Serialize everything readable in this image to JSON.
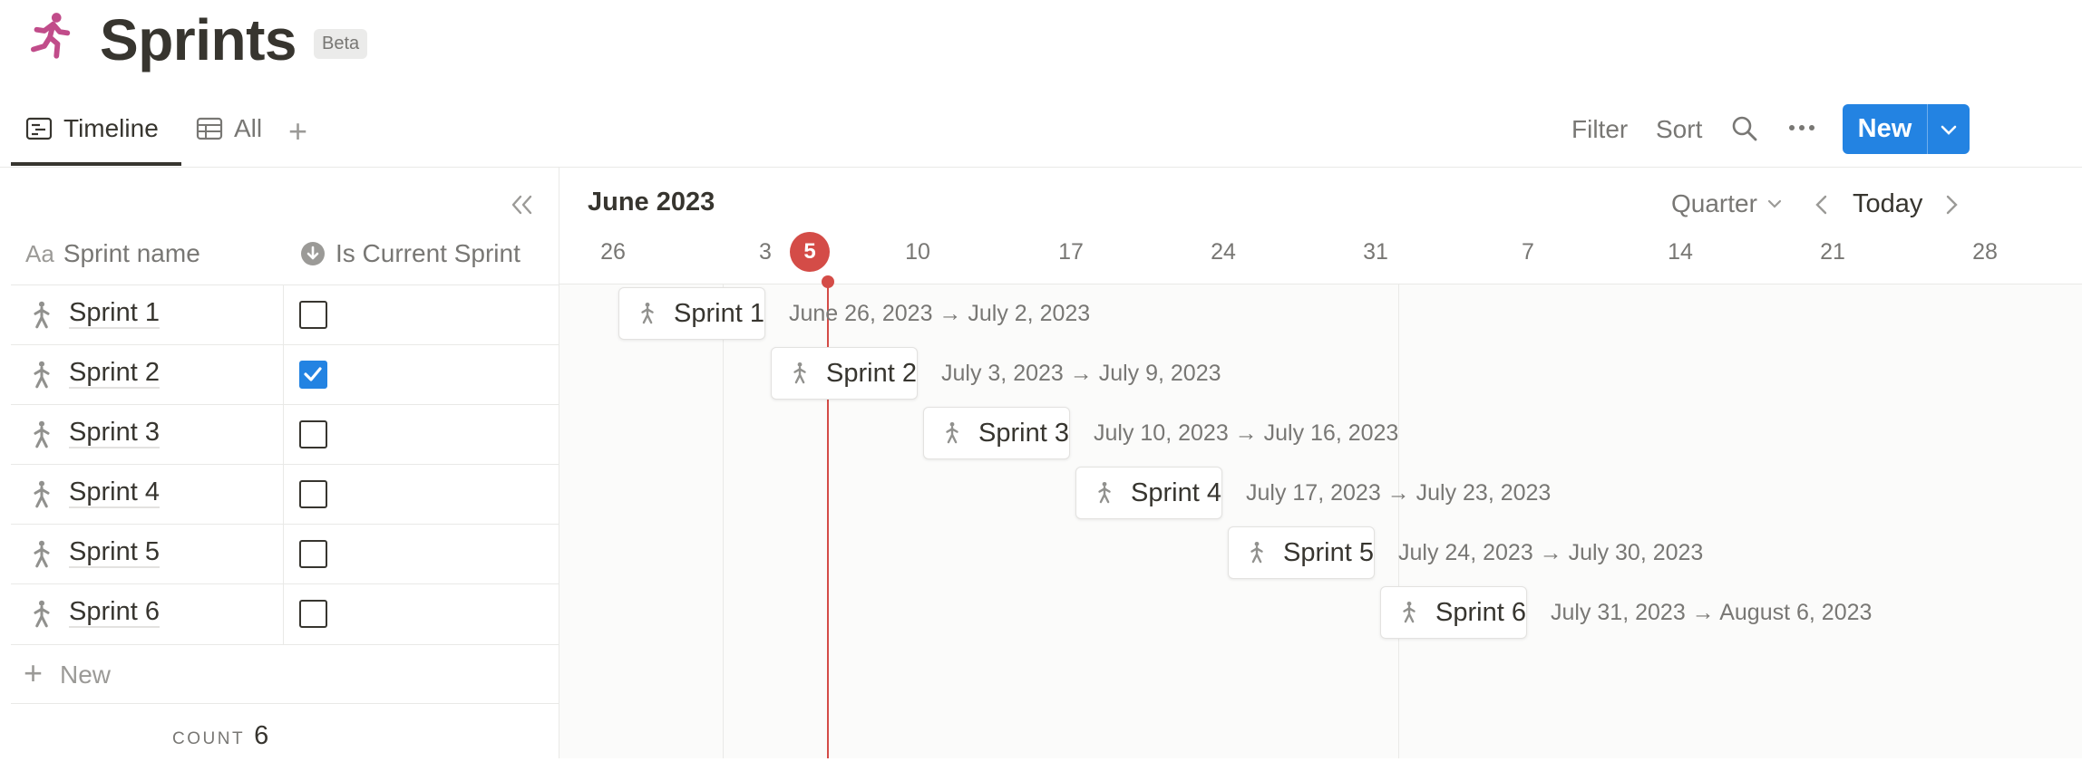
{
  "page": {
    "title": "Sprints",
    "badge": "Beta",
    "icon": "runner-icon",
    "icon_color": "#c14c8a"
  },
  "tabs": [
    {
      "label": "Timeline",
      "icon": "timeline-icon",
      "active": true
    },
    {
      "label": "All",
      "icon": "table-icon",
      "active": false
    }
  ],
  "toolbar": {
    "filter": "Filter",
    "sort": "Sort",
    "new": "New",
    "accent": "#2383e2"
  },
  "table": {
    "columns": {
      "name": "Sprint name",
      "name_prefix": "Aa",
      "current": "Is Current Sprint"
    },
    "rows": [
      {
        "name": "Sprint 1",
        "current": false
      },
      {
        "name": "Sprint 2",
        "current": true
      },
      {
        "name": "Sprint 3",
        "current": false
      },
      {
        "name": "Sprint 4",
        "current": false
      },
      {
        "name": "Sprint 5",
        "current": false
      },
      {
        "name": "Sprint 6",
        "current": false
      }
    ],
    "new_label": "New",
    "count_label": "COUNT",
    "count_value": "6"
  },
  "timeline": {
    "month": "June 2023",
    "scale": "Quarter",
    "today_label": "Today",
    "today_day": "5",
    "today_color": "#d44c47",
    "ticks": [
      "26",
      "3",
      "10",
      "17",
      "24",
      "31",
      "7",
      "14",
      "21",
      "28"
    ],
    "items": [
      {
        "title": "Sprint 1",
        "dates": "June 26, 2023 → July 2, 2023"
      },
      {
        "title": "Sprint 2",
        "dates": "July 3, 2023 → July 9, 2023"
      },
      {
        "title": "Sprint 3",
        "dates": "July 10, 2023 → July 16, 2023"
      },
      {
        "title": "Sprint 4",
        "dates": "July 17, 2023 → July 23, 2023"
      },
      {
        "title": "Sprint 5",
        "dates": "July 24, 2023 → July 30, 2023"
      },
      {
        "title": "Sprint 6",
        "dates": "July 31, 2023 → August 6, 2023"
      }
    ]
  }
}
